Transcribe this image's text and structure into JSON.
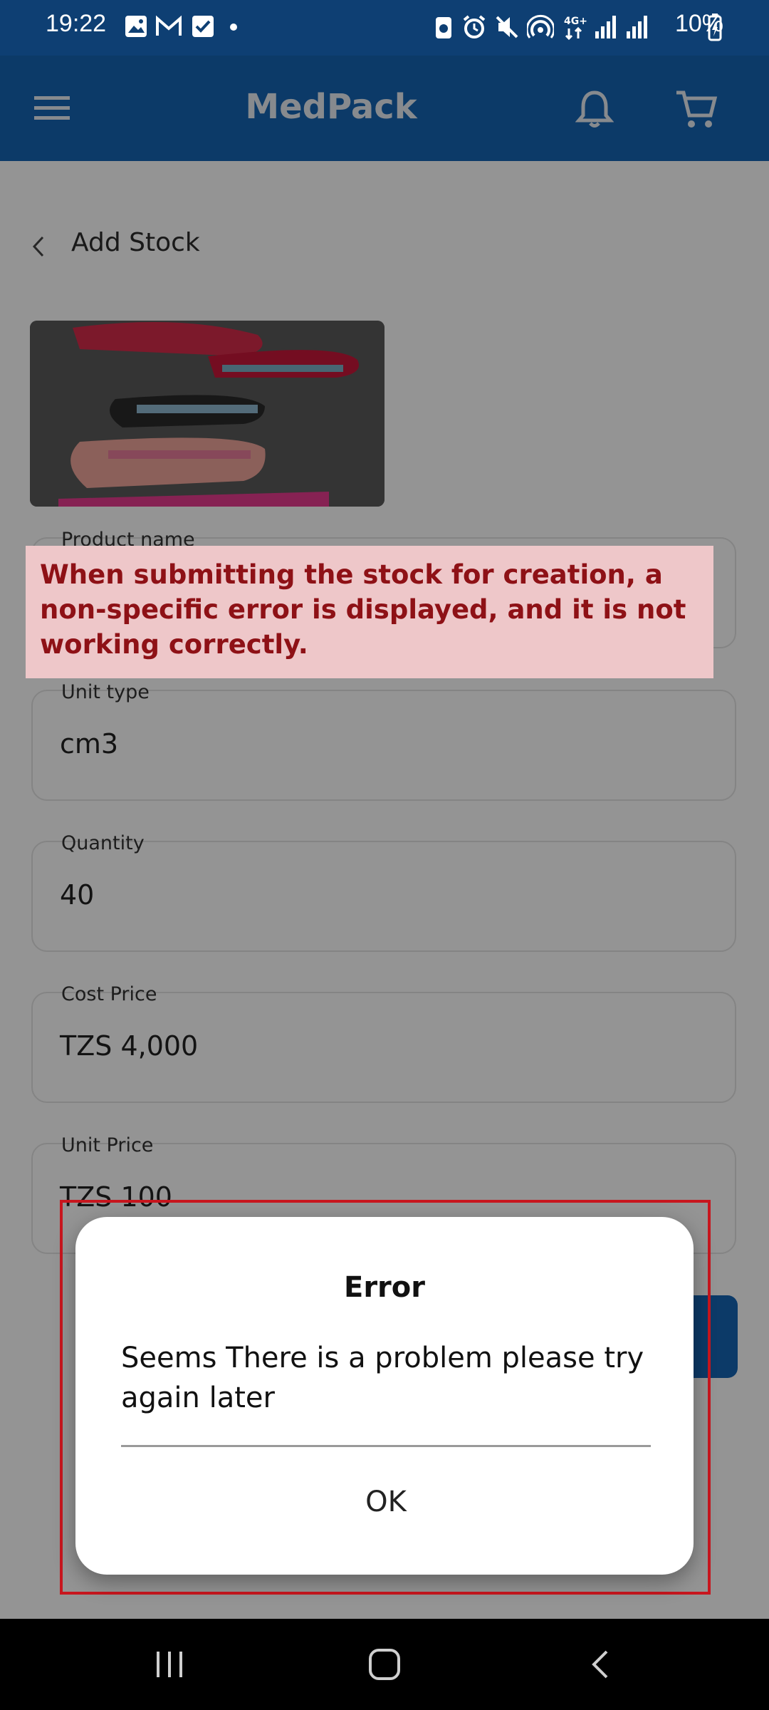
{
  "status_bar": {
    "time": "19:22",
    "battery": "10%",
    "icons": [
      "image-icon",
      "gmail-icon",
      "checkbox-icon",
      "dot-icon",
      "battery-saver-icon",
      "alarm-icon",
      "mute-icon",
      "hotspot-icon",
      "network-4g-icon",
      "signal-icon",
      "signal-icon",
      "battery-icon"
    ]
  },
  "app_bar": {
    "title": "MedPack",
    "icons": [
      "menu-icon",
      "bell-icon",
      "cart-icon"
    ],
    "color": "#1565b4"
  },
  "page": {
    "back_title": "Add Stock",
    "fields": [
      {
        "label": "Product name",
        "value": ""
      },
      {
        "label": "Unit type",
        "value": "cm3"
      },
      {
        "label": "Quantity",
        "value": "40"
      },
      {
        "label": "Cost Price",
        "value": "TZS 4,000"
      },
      {
        "label": "Unit Price",
        "value": "TZS 100"
      }
    ]
  },
  "annotation": {
    "text": "When submitting the stock for creation, a non-specific error is displayed, and it is not working correctly.",
    "color": "#8e1116"
  },
  "dialog": {
    "title": "Error",
    "message": "Seems There is a problem please try again later",
    "ok_label": "OK"
  },
  "nav_bar": {
    "icons": [
      "recents-icon",
      "home-icon",
      "back-icon"
    ]
  }
}
